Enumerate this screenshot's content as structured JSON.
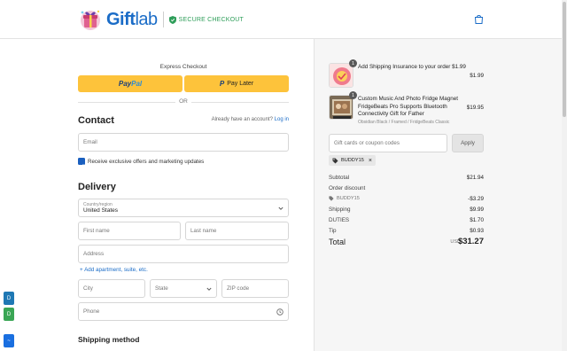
{
  "header": {
    "brand": "Gift",
    "brand_suffix": "lab",
    "secure_label": "SECURE CHECKOUT",
    "icons": {
      "logo": "giftlab-logo",
      "shield": "shield-icon",
      "cart": "shopping-bag-icon"
    }
  },
  "express": {
    "label": "Express Checkout",
    "paypal_a": "Pay",
    "paypal_b": "Pal",
    "paylater_label": "Pay Later",
    "paylater_mark": "P",
    "or_label": "OR"
  },
  "contact": {
    "heading": "Contact",
    "account_prompt": "Already have an account?",
    "login_link": "Log in",
    "email_placeholder": "Email",
    "marketing_label": "Receive exclusive offers and marketing updates",
    "marketing_checked": true
  },
  "delivery": {
    "heading": "Delivery",
    "country_label": "Country/region",
    "country_value": "United States",
    "first_name_placeholder": "First name",
    "last_name_placeholder": "Last name",
    "address_placeholder": "Address",
    "add_apartment": "+ Add apartment, suite, etc.",
    "city_placeholder": "City",
    "state_placeholder": "State",
    "zip_placeholder": "ZIP code",
    "phone_placeholder": "Phone"
  },
  "shipping_method": {
    "heading": "Shipping method"
  },
  "side_tabs": [
    {
      "label": "D",
      "color": "#1f78b4"
    },
    {
      "label": "D",
      "color": "#3aa655"
    },
    {
      "label": "~",
      "color": "#1a6fe0"
    }
  ],
  "order": {
    "items": [
      {
        "qty": "1",
        "title": "Add Shipping Insurance to your order $1.99",
        "price": "$1.99"
      },
      {
        "qty": "1",
        "title": "Custom Music And Photo Fridge Magnet FridgeBeats Pro Supports Bluetooth Connectivity Gift for Father",
        "subtitle": "Obsidian Black / Framed / FridgeBeats Classic",
        "price": "$19.95"
      }
    ],
    "coupon_placeholder": "Gift cards or coupon codes",
    "apply_label": "Apply",
    "applied_code": "BUDDY15",
    "subtotal_label": "Subtotal",
    "subtotal": "$21.94",
    "order_discount_label": "Order discount",
    "discount_code": "BUDDY15",
    "discount": "-$3.29",
    "shipping_label": "Shipping",
    "shipping": "$9.99",
    "duties_label": "DUTIES",
    "duties": "$1.70",
    "tip_label": "Tip",
    "tip": "$0.93",
    "total_label": "Total",
    "currency": "USD",
    "total": "$31.27"
  }
}
